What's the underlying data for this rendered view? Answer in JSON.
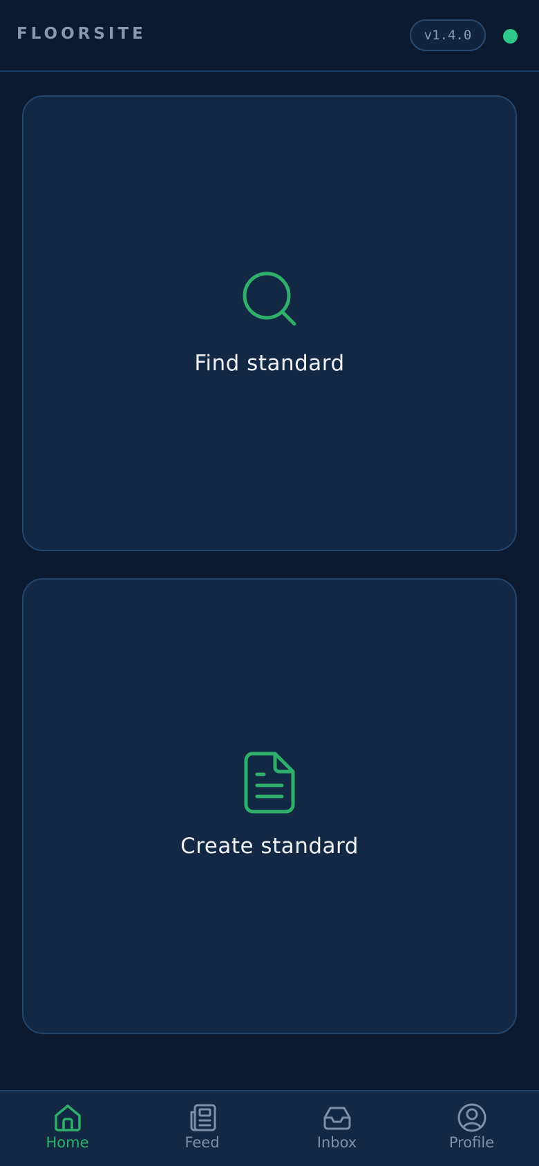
{
  "header": {
    "brand": "FLOORSITE",
    "version": "v1.4.0",
    "status_color": "#2ec98b"
  },
  "cards": {
    "find": {
      "label": "Find standard",
      "icon": "search-icon"
    },
    "create": {
      "label": "Create standard",
      "icon": "document-icon"
    }
  },
  "nav": {
    "items": [
      {
        "label": "Home",
        "icon": "home-icon",
        "active": true
      },
      {
        "label": "Feed",
        "icon": "newspaper-icon",
        "active": false
      },
      {
        "label": "Inbox",
        "icon": "inbox-icon",
        "active": false
      },
      {
        "label": "Profile",
        "icon": "profile-icon",
        "active": false
      }
    ]
  },
  "colors": {
    "accent": "#2fb06a",
    "background": "#0b1a2e",
    "card": "#132843",
    "muted_text": "#7f91a9"
  }
}
